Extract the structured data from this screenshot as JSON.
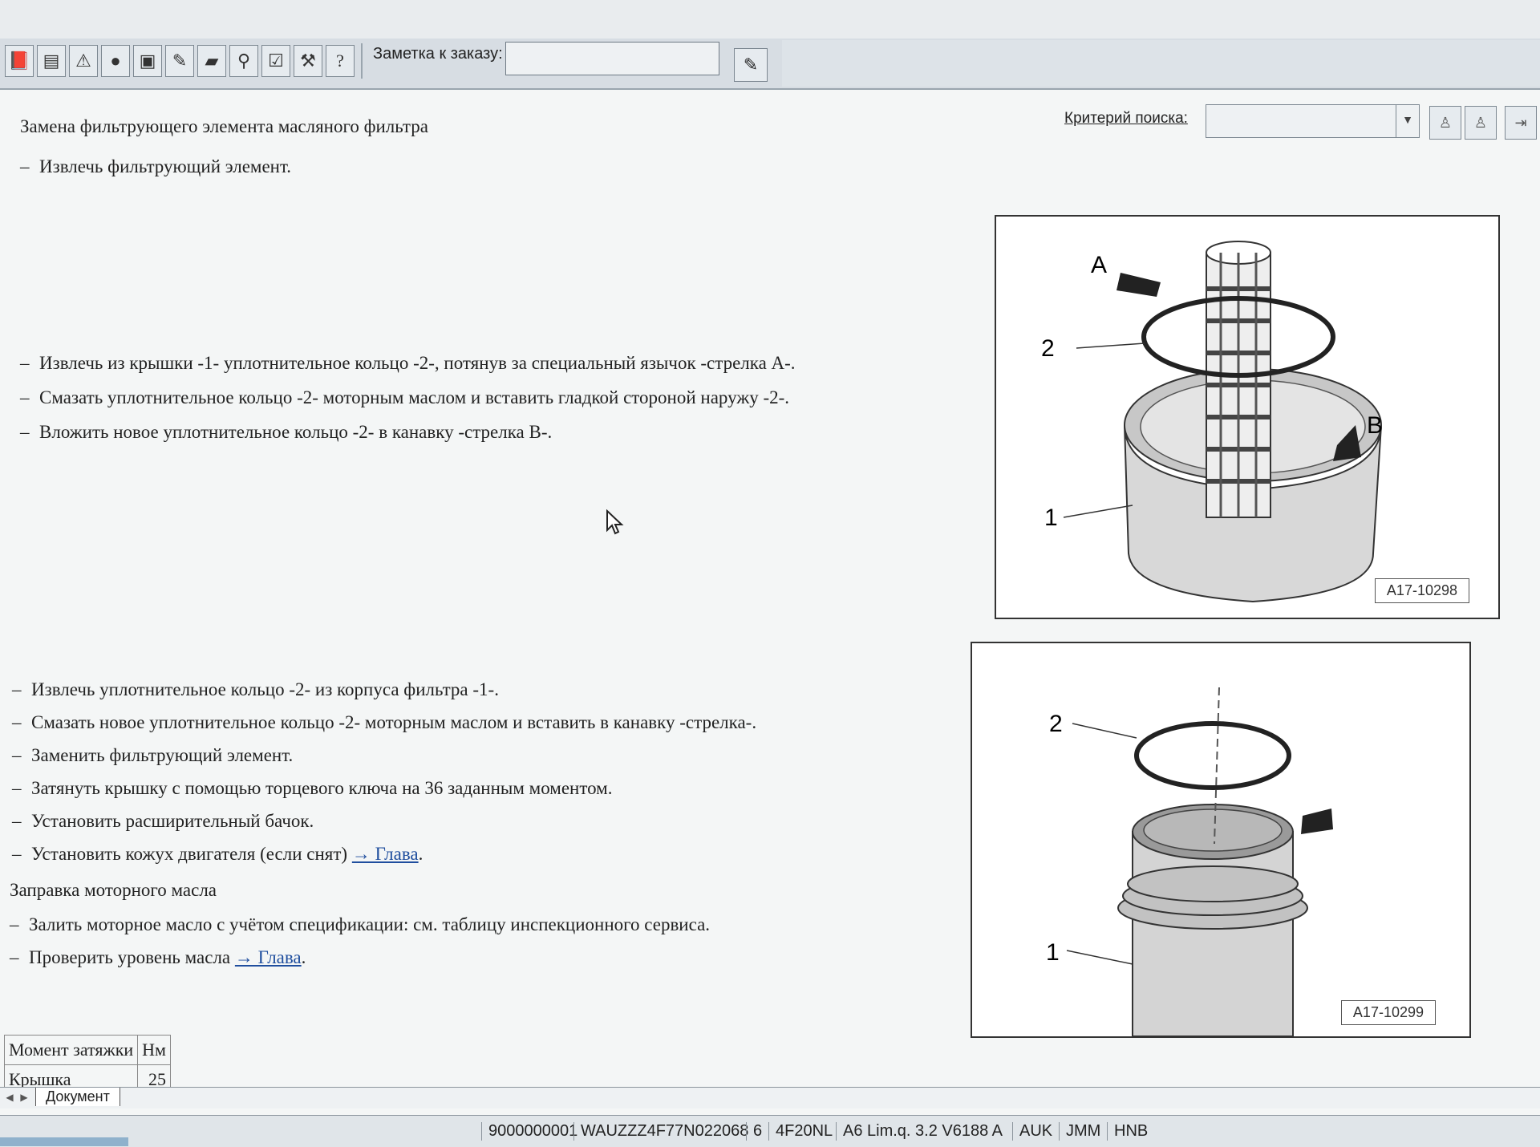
{
  "toolbar": {
    "icons": [
      "book-icon",
      "document-icon",
      "warning-icon",
      "globe-icon",
      "save-icon",
      "pen-icon",
      "car-icon",
      "car-search-icon",
      "checklist-icon",
      "tools-icon",
      "help-icon"
    ],
    "note_label": "Заметка к заказу:",
    "note_value": ""
  },
  "search": {
    "label": "Критерий поиска:",
    "value": ""
  },
  "document": {
    "title": "Замена фильтрующего элемента масляного фильтра",
    "steps_group1": [
      "Извлечь фильтрующий элемент."
    ],
    "steps_group2": [
      "Извлечь из крышки -1- уплотнительное кольцо -2-, потянув за специальный язычок -стрелка А-.",
      "Смазать уплотнительное кольцо -2- моторным маслом и вставить гладкой стороной наружу -2-.",
      "Вложить новое уплотнительное кольцо -2- в канавку -стрелка В-."
    ],
    "steps_group3": [
      "Извлечь уплотнительное кольцо -2- из корпуса фильтра -1-.",
      "Смазать новое уплотнительное кольцо -2- моторным маслом и вставить в канавку -стрелка-.",
      "Заменить фильтрующий элемент.",
      "Затянуть крышку с помощью торцевого ключа на 36 заданным моментом.",
      "Установить расширительный бачок."
    ],
    "step_with_link_1": {
      "text": "Установить кожух двигателя (если снят)",
      "link": "→ Глава"
    },
    "section_heading": "Заправка моторного масла",
    "step_oil": "Залить моторное масло с учётом спецификации: см. таблицу инспекционного сервиса.",
    "step_with_link_2": {
      "text": "Проверить уровень масла",
      "link": "→ Глава"
    }
  },
  "figures": [
    {
      "code": "A17-10298",
      "labels": [
        "A",
        "2",
        "B",
        "1"
      ]
    },
    {
      "code": "A17-10299",
      "labels": [
        "2",
        "1"
      ]
    }
  ],
  "torque_table": {
    "headers": [
      "Момент затяжки",
      "Нм"
    ],
    "rows": [
      [
        "Крышка",
        "25"
      ]
    ]
  },
  "tabs": {
    "document_tab": "Документ"
  },
  "status_bar": [
    "9000000001",
    "WAUZZZ4F77N022068",
    "6",
    "4F20NL",
    "A6 Lim.q. 3.2 V6188 A",
    "AUK",
    "JMM",
    "HNB"
  ]
}
